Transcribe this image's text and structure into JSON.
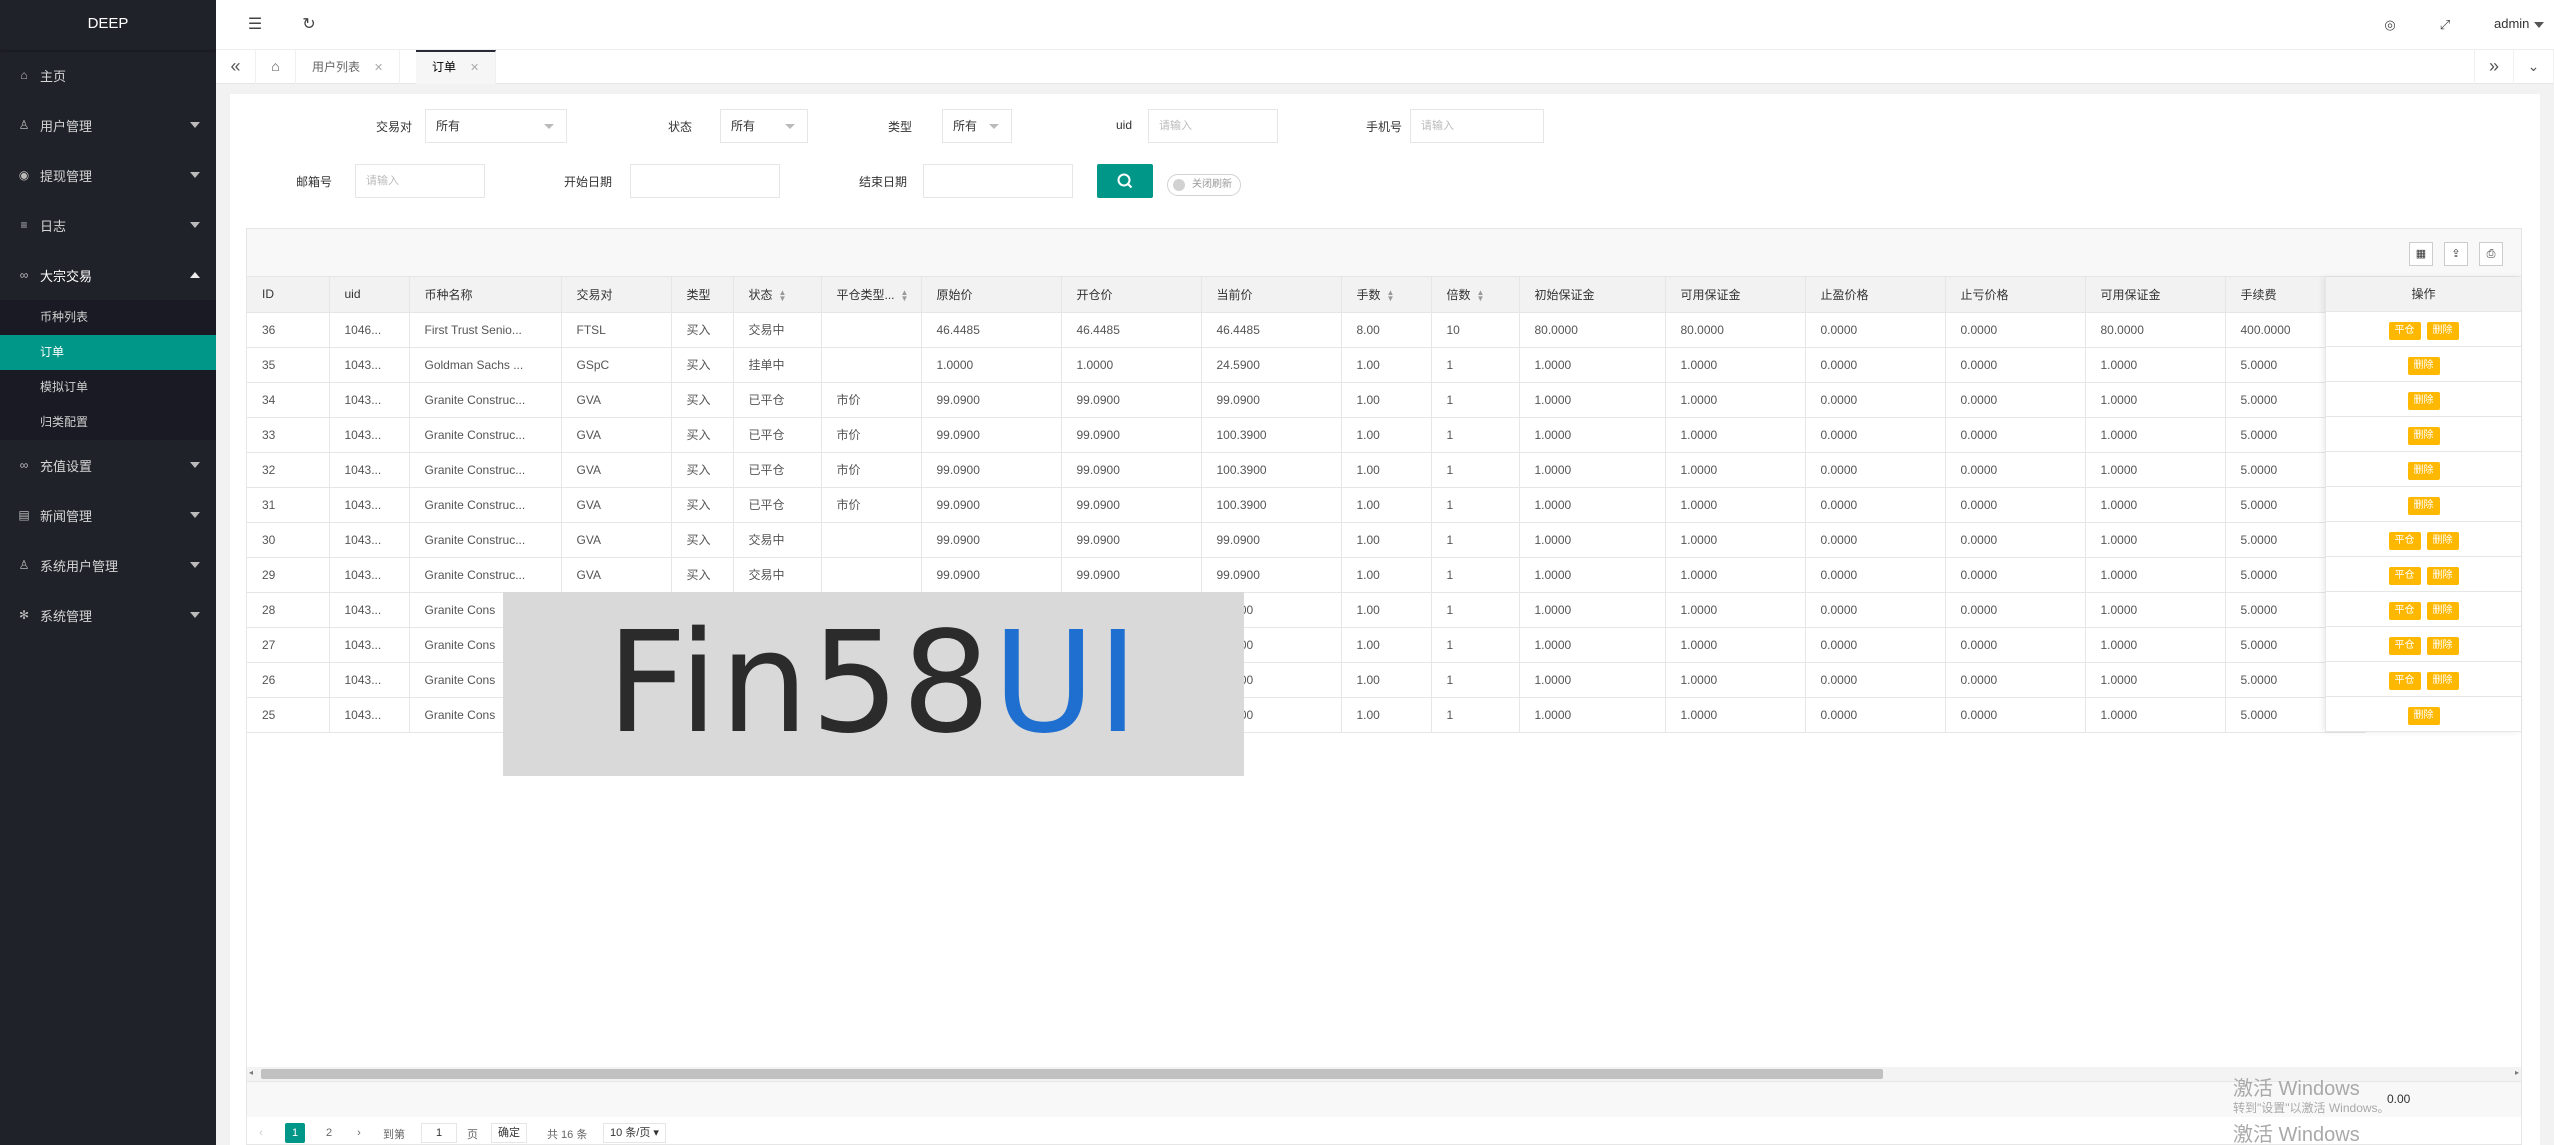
{
  "app": {
    "logo": "DEEP"
  },
  "sidebar": {
    "items": [
      {
        "icon": "home-icon",
        "label": "主页"
      },
      {
        "icon": "user-icon",
        "label": "用户管理"
      },
      {
        "icon": "withdraw-icon",
        "label": "提现管理"
      },
      {
        "icon": "log-icon",
        "label": "日志"
      },
      {
        "icon": "trade-icon",
        "label": "大宗交易",
        "open": true,
        "children": [
          "币种列表",
          "订单",
          "模拟订单",
          "归类配置"
        ],
        "active_child": "订单"
      },
      {
        "icon": "recharge-icon",
        "label": "充值设置"
      },
      {
        "icon": "news-icon",
        "label": "新闻管理"
      },
      {
        "icon": "sys-user-icon",
        "label": "系统用户管理"
      },
      {
        "icon": "settings-icon",
        "label": "系统管理"
      }
    ]
  },
  "header": {
    "user": "admin"
  },
  "tabs": {
    "items": [
      "用户列表",
      "订单"
    ],
    "active": "订单"
  },
  "filters": {
    "pair_label": "交易对",
    "pair_value": "所有",
    "status_label": "状态",
    "status_value": "所有",
    "type_label": "类型",
    "type_value": "所有",
    "uid_label": "uid",
    "uid_placeholder": "请输入",
    "phone_label": "手机号",
    "phone_placeholder": "请输入",
    "email_label": "邮箱号",
    "email_placeholder": "请输入",
    "start_label": "开始日期",
    "end_label": "结束日期",
    "refresh_toggle": "关闭刷新"
  },
  "table": {
    "columns": [
      "ID",
      "uid",
      "币种名称",
      "交易对",
      "类型",
      "状态",
      "平仓类型...",
      "原始价",
      "开仓价",
      "当前价",
      "手数",
      "倍数",
      "初始保证金",
      "可用保证金",
      "止盈价格",
      "止亏价格",
      "可用保证金",
      "手续费"
    ],
    "sortable": [
      5,
      6,
      10,
      11
    ],
    "ops_header": "操作",
    "rows": [
      [
        "36",
        "1046...",
        "First Trust Senio...",
        "FTSL",
        "买入",
        "交易中",
        "",
        "46.4485",
        "46.4485",
        "46.4485",
        "8.00",
        "10",
        "80.0000",
        "80.0000",
        "0.0000",
        "0.0000",
        "80.0000",
        "400.0000"
      ],
      [
        "35",
        "1043...",
        "Goldman Sachs ...",
        "GSpC",
        "买入",
        "挂单中",
        "",
        "1.0000",
        "1.0000",
        "24.5900",
        "1.00",
        "1",
        "1.0000",
        "1.0000",
        "0.0000",
        "0.0000",
        "1.0000",
        "5.0000"
      ],
      [
        "34",
        "1043...",
        "Granite Construc...",
        "GVA",
        "买入",
        "已平仓",
        "市价",
        "99.0900",
        "99.0900",
        "99.0900",
        "1.00",
        "1",
        "1.0000",
        "1.0000",
        "0.0000",
        "0.0000",
        "1.0000",
        "5.0000"
      ],
      [
        "33",
        "1043...",
        "Granite Construc...",
        "GVA",
        "买入",
        "已平仓",
        "市价",
        "99.0900",
        "99.0900",
        "100.3900",
        "1.00",
        "1",
        "1.0000",
        "1.0000",
        "0.0000",
        "0.0000",
        "1.0000",
        "5.0000"
      ],
      [
        "32",
        "1043...",
        "Granite Construc...",
        "GVA",
        "买入",
        "已平仓",
        "市价",
        "99.0900",
        "99.0900",
        "100.3900",
        "1.00",
        "1",
        "1.0000",
        "1.0000",
        "0.0000",
        "0.0000",
        "1.0000",
        "5.0000"
      ],
      [
        "31",
        "1043...",
        "Granite Construc...",
        "GVA",
        "买入",
        "已平仓",
        "市价",
        "99.0900",
        "99.0900",
        "100.3900",
        "1.00",
        "1",
        "1.0000",
        "1.0000",
        "0.0000",
        "0.0000",
        "1.0000",
        "5.0000"
      ],
      [
        "30",
        "1043...",
        "Granite Construc...",
        "GVA",
        "买入",
        "交易中",
        "",
        "99.0900",
        "99.0900",
        "99.0900",
        "1.00",
        "1",
        "1.0000",
        "1.0000",
        "0.0000",
        "0.0000",
        "1.0000",
        "5.0000"
      ],
      [
        "29",
        "1043...",
        "Granite Construc...",
        "GVA",
        "买入",
        "交易中",
        "",
        "99.0900",
        "99.0900",
        "99.0900",
        "1.00",
        "1",
        "1.0000",
        "1.0000",
        "0.0000",
        "0.0000",
        "1.0000",
        "5.0000"
      ],
      [
        "28",
        "1043...",
        "Granite Cons",
        "",
        "",
        "",
        "",
        "",
        "",
        "...9900",
        "1.00",
        "1",
        "1.0000",
        "1.0000",
        "0.0000",
        "0.0000",
        "1.0000",
        "5.0000"
      ],
      [
        "27",
        "1043...",
        "Granite Cons",
        "",
        "",
        "",
        "",
        "",
        "",
        "...9900",
        "1.00",
        "1",
        "1.0000",
        "1.0000",
        "0.0000",
        "0.0000",
        "1.0000",
        "5.0000"
      ],
      [
        "26",
        "1043...",
        "Granite Cons",
        "",
        "",
        "",
        "",
        "",
        "",
        "...9900",
        "1.00",
        "1",
        "1.0000",
        "1.0000",
        "0.0000",
        "0.0000",
        "1.0000",
        "5.0000"
      ],
      [
        "25",
        "1043...",
        "Granite Cons",
        "",
        "",
        "",
        "",
        "",
        "",
        "...3900",
        "1.00",
        "1",
        "1.0000",
        "1.0000",
        "0.0000",
        "0.0000",
        "1.0000",
        "5.0000"
      ]
    ],
    "ops": [
      [
        "平仓",
        "删除"
      ],
      [
        "删除"
      ],
      [
        "删除"
      ],
      [
        "删除"
      ],
      [
        "删除"
      ],
      [
        "删除"
      ],
      [
        "平仓",
        "删除"
      ],
      [
        "平仓",
        "删除"
      ],
      [
        "平仓",
        "删除"
      ],
      [
        "平仓",
        "删除"
      ],
      [
        "平仓",
        "删除"
      ],
      [
        "删除"
      ]
    ],
    "total_fee": "0.00"
  },
  "pager": {
    "pages": [
      "1",
      "2"
    ],
    "current": "1",
    "goto_label": "到第",
    "goto_value": "1",
    "page_unit": "页",
    "confirm": "确定",
    "total": "共 16 条",
    "size": "10 条/页"
  },
  "overlay": {
    "watermark_a": "Fin58",
    "watermark_b": "UI"
  },
  "os_watermark": {
    "line1": "激活 Windows",
    "line2": "转到\"设置\"以激活 Windows。",
    "line3": "激活 Windows"
  }
}
